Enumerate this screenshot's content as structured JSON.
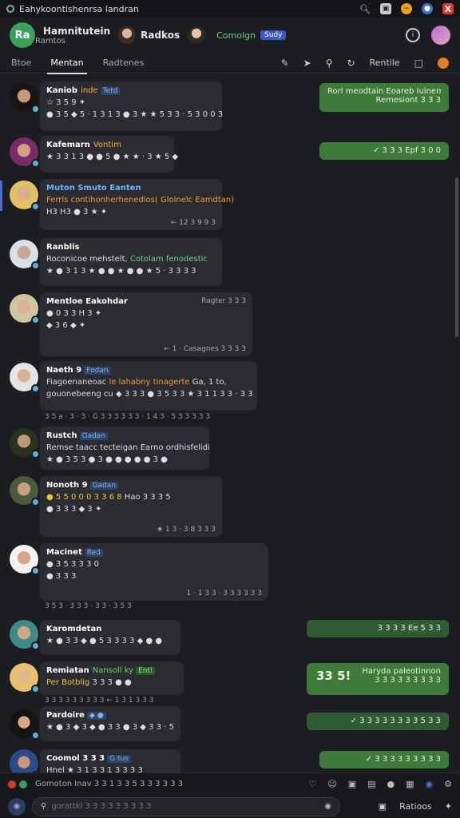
{
  "window": {
    "title": "Eahykoontishenrsa landran"
  },
  "header": {
    "logo_text": "Ra",
    "name": "Hamnitutein",
    "subtitle": "Ramtos",
    "contact": "Radkos",
    "status": "Comolgn",
    "badge": "Sudy"
  },
  "tabs": [
    {
      "label": "Btoe"
    },
    {
      "label": "Mentan"
    },
    {
      "label": "Radtenes"
    }
  ],
  "toolbar": {
    "refresh_label": "Rentile"
  },
  "messages": [
    {
      "name": "Kaniob",
      "tag_yellow": "inde",
      "tag": "Tetd",
      "line1": "☆ 3 5 9 ✦",
      "line2": "● 3 5 ◆ 5 · 1 3 1 3  ● 3 ★ ★ 5 3 3 · 5 3 0 0 3"
    },
    {
      "name": "Kafemarn",
      "tag_yellow": "Vontim",
      "line1": "★ 3 3 1 3 ● ● 5 ● ★ ★ · 3 ★ 5 ◆",
      "line2": ""
    },
    {
      "name": "Muton Smuto Eanten",
      "line1": "Ferrls contihonherhenedlos( Glolnelc Eamdtan)",
      "line2": "H3 H3 ● 3 ★ ✦",
      "time": "← 12 3 9 9 3"
    },
    {
      "name": "Ranblis",
      "line1": "Roconicoe mehstelt,",
      "line1_green": "Cotolam fenodestic",
      "line2": "★ ● 3 1 3  ★ ● ● ★ ● ● ★  5 · 3 3 3 3"
    },
    {
      "name": "Mentloe Eakohdar",
      "line1": "● 0 3  3 H 3 ✦",
      "line2": "◆ 3 6 ◆ ✦",
      "time_top": "Ragter 3 3 3",
      "time": "← 1 · Casagnes 3 3 3 3"
    },
    {
      "name": "Naeth 9",
      "tag": "Fodan",
      "line1": "Fiagoenaneoac",
      "line1_orange": "le lahabny tinagerte",
      "line1_tail": "Ga, 1 to,",
      "line2": "gouonebeeng cu ◆ 3 3 3 ● 3 5 3 3 ★ 3 1 1 3 3 · 3 3",
      "below": "3 5 a · 3 · 3 · G 3 3 3 3 3 3  · 1 4 3 · 5 3 3 3 3 3"
    },
    {
      "name": "Rustch",
      "tag": "Gadan",
      "line1": "Remse taacc tecteigan Earno ordhisfelidi",
      "line2": "★ ● 3 5 3 ● 3 ● ● ● ● ● 3 ●"
    },
    {
      "name": "Nonoth 9",
      "tag": "Gadan",
      "line1_yellow": "● 5 5 0 0 0 3 3 6 8",
      "line1": "Hao 3 3 3 5",
      "line2": "● 3 3 3 ◆ 3 ✦",
      "time": "★ 1 3 · 3 8 3 3 3"
    },
    {
      "name": "Macinet",
      "tag": "Red",
      "line1": "● 3 5 3  3 3 0",
      "line2": "● 3 3 3",
      "time": "1 · 1 3 3 · 3 3 3 3 3 3",
      "below": "3 5 3 · 3 3 3 · 3 3 · 3 5 3"
    },
    {
      "name": "Karomdetan",
      "line1": "★ ● 3 3 ◆ ● 5 3 3 3 3 ◆ ● ●"
    },
    {
      "name": "Remiatan",
      "tag_green": "Nansoll ky",
      "tag": "Entl",
      "line1": "Per Botblig",
      "line1_tail": "3 3 3 ● ●",
      "below": "3 3 3 3 3   3 3 3 3  ← 1 3 1 3 3 3"
    },
    {
      "name": "Pardoire",
      "tag": "◆ ●",
      "line1": "★ ● 3 ◆ 3 ◆ ● 3 3 ● 3 ◆ 3 3 · 5"
    },
    {
      "name": "Coomol 3 3 3",
      "tag": "G tus",
      "line1": "Hnel ★ 3 1 3 3 1 3 3 3 3"
    }
  ],
  "outgoing": [
    {
      "line1": "Rorl meodtain Eoareb Iuinemon",
      "line2": "Remesiont 3 3 3"
    },
    {
      "line1": "✓ 3 3 3 Epf 3 0 0"
    },
    {
      "line1": "3 3 3 3 Ee 5 3 3"
    },
    {
      "prefix": "33 5!",
      "line1": "Haryda paleotinnon",
      "line2": "3 3 3 3 3 3 3 3 3"
    },
    {
      "line1": "✓ 3 3 3 3 3 3 3 3 5 3 3"
    },
    {
      "line1": "✓ 3 3 3 3 3 3 3 3 3"
    }
  ],
  "composer": {
    "top_label": "Gomoton Inav 3 3 1 3 3 5 3 3 3 3 3 3",
    "placeholder": "gorattkl 3 3 3 3 3 3 3 3 3",
    "right_label": "Ratioos"
  },
  "colors": {
    "accent_green": "#3e7a3a",
    "tag_blue": "#28476a",
    "online": "#5ab0d8"
  }
}
